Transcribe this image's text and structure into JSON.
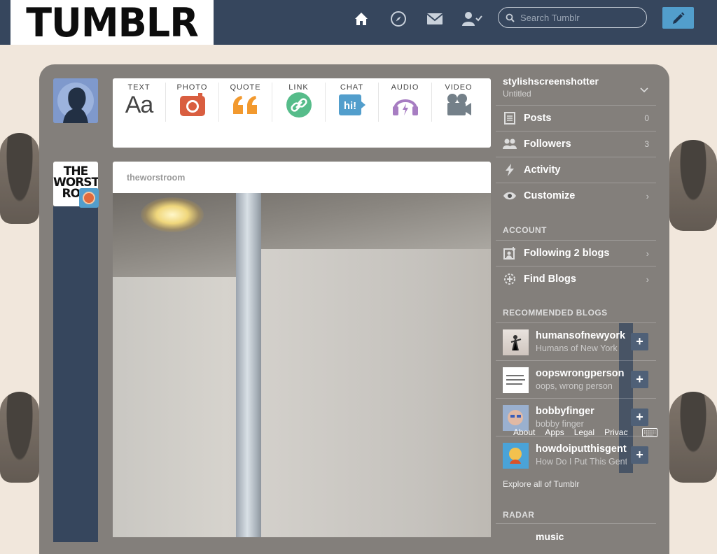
{
  "logo": {
    "text": "TUMBLR"
  },
  "nav": {
    "search_placeholder": "Search Tumblr",
    "icons": [
      "home-icon",
      "explore-icon",
      "inbox-icon",
      "account-icon",
      "compose-icon"
    ]
  },
  "composer": {
    "types": [
      {
        "label": "TEXT",
        "color": "#444444"
      },
      {
        "label": "PHOTO",
        "color": "#d95e40"
      },
      {
        "label": "QUOTE",
        "color": "#f2992e"
      },
      {
        "label": "LINK",
        "color": "#56bc8a"
      },
      {
        "label": "CHAT",
        "color": "#529ecc"
      },
      {
        "label": "AUDIO",
        "color": "#a77dc2"
      },
      {
        "label": "VIDEO",
        "color": "#748089"
      }
    ]
  },
  "post": {
    "blog": "theworstroom",
    "avatar_text": "THE WORST ROO"
  },
  "sidebar": {
    "blog_name": "stylishscreenshotter",
    "blog_title": "Untitled",
    "menu": [
      {
        "label": "Posts",
        "count": "0"
      },
      {
        "label": "Followers",
        "count": "3"
      },
      {
        "label": "Activity",
        "count": ""
      },
      {
        "label": "Customize",
        "count": ""
      }
    ],
    "account_heading": "ACCOUNT",
    "account": [
      {
        "label": "Following 2 blogs"
      },
      {
        "label": "Find Blogs"
      }
    ],
    "recommended_heading": "RECOMMENDED BLOGS",
    "recommended": [
      {
        "name": "humansofnewyork",
        "desc": "Humans of New York"
      },
      {
        "name": "oopswrongperson",
        "desc": "oops, wrong person"
      },
      {
        "name": "bobbyfinger",
        "desc": "bobby finger"
      },
      {
        "name": "howdoiputthisgently",
        "desc": "How Do I Put This Gently"
      }
    ],
    "footer": [
      "About",
      "Apps",
      "Legal",
      "Privacy"
    ],
    "explore": "Explore all of Tumblr",
    "radar_heading": "RADAR",
    "radar_item": "music"
  }
}
